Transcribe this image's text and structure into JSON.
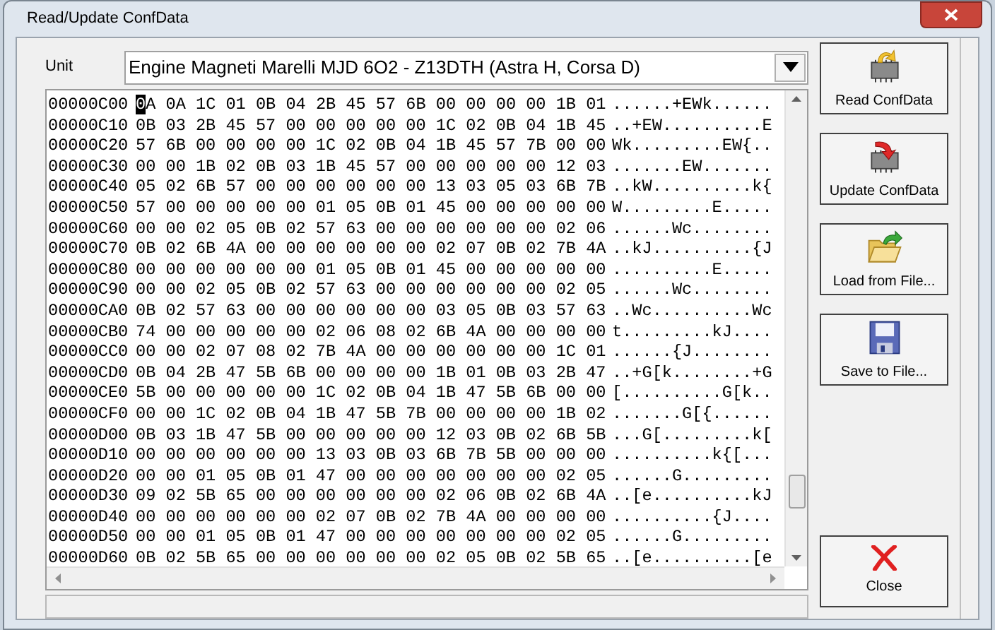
{
  "window": {
    "title": "Read/Update ConfData"
  },
  "unit": {
    "label": "Unit",
    "value": "Engine Magneti Marelli MJD 6O2 - Z13DTH (Astra H, Corsa D)"
  },
  "hex_rows": [
    {
      "address": "00000C00",
      "bytes": "0A 0A 1C 01 0B 04 2B 45 57 6B 00 00 00 00 1B 01",
      "ascii": "......+EWk......",
      "cursor": true
    },
    {
      "address": "00000C10",
      "bytes": "0B 03 2B 45 57 00 00 00 00 00 1C 02 0B 04 1B 45",
      "ascii": "..+EW..........E",
      "cursor": false
    },
    {
      "address": "00000C20",
      "bytes": "57 6B 00 00 00 00 1C 02 0B 04 1B 45 57 7B 00 00",
      "ascii": "Wk.........EW{..",
      "cursor": false
    },
    {
      "address": "00000C30",
      "bytes": "00 00 1B 02 0B 03 1B 45 57 00 00 00 00 00 12 03",
      "ascii": ".......EW.......",
      "cursor": false
    },
    {
      "address": "00000C40",
      "bytes": "05 02 6B 57 00 00 00 00 00 00 13 03 05 03 6B 7B",
      "ascii": "..kW..........k{",
      "cursor": false
    },
    {
      "address": "00000C50",
      "bytes": "57 00 00 00 00 00 01 05 0B 01 45 00 00 00 00 00",
      "ascii": "W.........E.....",
      "cursor": false
    },
    {
      "address": "00000C60",
      "bytes": "00 00 02 05 0B 02 57 63 00 00 00 00 00 00 02 06",
      "ascii": "......Wc........",
      "cursor": false
    },
    {
      "address": "00000C70",
      "bytes": "0B 02 6B 4A 00 00 00 00 00 00 02 07 0B 02 7B 4A",
      "ascii": "..kJ..........{J",
      "cursor": false
    },
    {
      "address": "00000C80",
      "bytes": "00 00 00 00 00 00 01 05 0B 01 45 00 00 00 00 00",
      "ascii": "..........E.....",
      "cursor": false
    },
    {
      "address": "00000C90",
      "bytes": "00 00 02 05 0B 02 57 63 00 00 00 00 00 00 02 05",
      "ascii": "......Wc........",
      "cursor": false
    },
    {
      "address": "00000CA0",
      "bytes": "0B 02 57 63 00 00 00 00 00 00 03 05 0B 03 57 63",
      "ascii": "..Wc..........Wc",
      "cursor": false
    },
    {
      "address": "00000CB0",
      "bytes": "74 00 00 00 00 00 02 06 08 02 6B 4A 00 00 00 00",
      "ascii": "t.........kJ....",
      "cursor": false
    },
    {
      "address": "00000CC0",
      "bytes": "00 00 02 07 08 02 7B 4A 00 00 00 00 00 00 1C 01",
      "ascii": "......{J........",
      "cursor": false
    },
    {
      "address": "00000CD0",
      "bytes": "0B 04 2B 47 5B 6B 00 00 00 00 1B 01 0B 03 2B 47",
      "ascii": "..+G[k........+G",
      "cursor": false
    },
    {
      "address": "00000CE0",
      "bytes": "5B 00 00 00 00 00 1C 02 0B 04 1B 47 5B 6B 00 00",
      "ascii": "[..........G[k..",
      "cursor": false
    },
    {
      "address": "00000CF0",
      "bytes": "00 00 1C 02 0B 04 1B 47 5B 7B 00 00 00 00 1B 02",
      "ascii": ".......G[{......",
      "cursor": false
    },
    {
      "address": "00000D00",
      "bytes": "0B 03 1B 47 5B 00 00 00 00 00 12 03 0B 02 6B 5B",
      "ascii": "...G[.........k[",
      "cursor": false
    },
    {
      "address": "00000D10",
      "bytes": "00 00 00 00 00 00 13 03 0B 03 6B 7B 5B 00 00 00",
      "ascii": "..........k{[...",
      "cursor": false
    },
    {
      "address": "00000D20",
      "bytes": "00 00 01 05 0B 01 47 00 00 00 00 00 00 00 02 05",
      "ascii": "......G.........",
      "cursor": false
    },
    {
      "address": "00000D30",
      "bytes": "09 02 5B 65 00 00 00 00 00 00 02 06 0B 02 6B 4A",
      "ascii": "..[e..........kJ",
      "cursor": false
    },
    {
      "address": "00000D40",
      "bytes": "00 00 00 00 00 00 02 07 0B 02 7B 4A 00 00 00 00",
      "ascii": "..........{J....",
      "cursor": false
    },
    {
      "address": "00000D50",
      "bytes": "00 00 01 05 0B 01 47 00 00 00 00 00 00 00 02 05",
      "ascii": "......G.........",
      "cursor": false
    },
    {
      "address": "00000D60",
      "bytes": "0B 02 5B 65 00 00 00 00 00 00 02 05 0B 02 5B 65",
      "ascii": "..[e..........[e",
      "cursor": false
    }
  ],
  "buttons": [
    {
      "kind": "read",
      "label": "Read ConfData"
    },
    {
      "kind": "update",
      "label": "Update ConfData"
    },
    {
      "kind": "load",
      "label": "Load from File..."
    },
    {
      "kind": "save",
      "label": "Save to File..."
    }
  ],
  "close_button": {
    "label": "Close"
  }
}
